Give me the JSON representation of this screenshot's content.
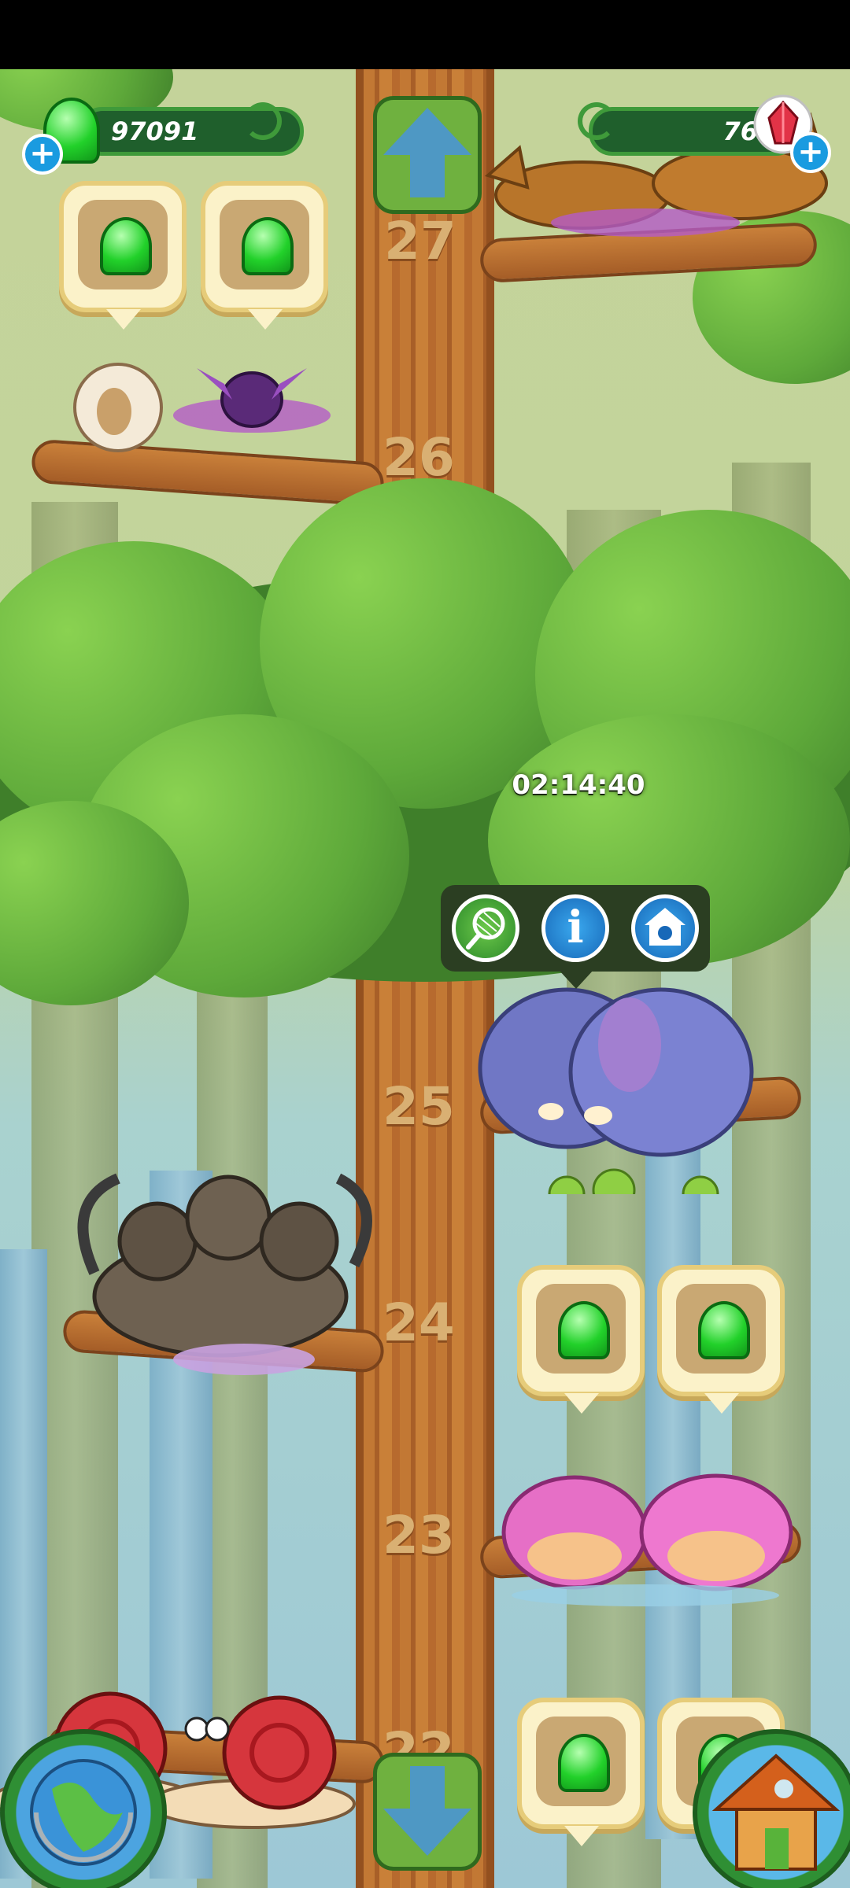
{
  "status_bar": {},
  "currency": {
    "green_gems": "97091",
    "red_crystals": "76"
  },
  "timer": "02:14:40",
  "floors": [
    "27",
    "26",
    "25",
    "24",
    "23",
    "22"
  ],
  "action_buttons": [
    {
      "name": "net-icon"
    },
    {
      "name": "info-icon",
      "glyph": "i"
    },
    {
      "name": "home-icon"
    }
  ],
  "colors": {
    "gem_green": "#22d12a",
    "counter_bg": "#1f5f2c",
    "trunk": "#c27834",
    "bubble": "#fbf2c9"
  }
}
